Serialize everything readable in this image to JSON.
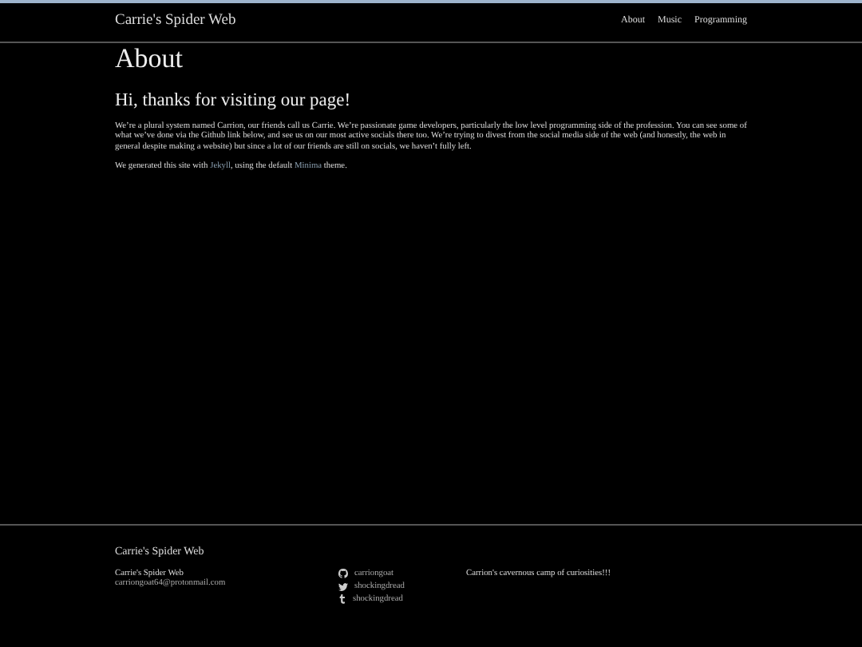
{
  "header": {
    "site_title": "Carrie's Spider Web",
    "nav": [
      "About",
      "Music",
      "Programming"
    ]
  },
  "page": {
    "title": "About",
    "heading": "Hi, thanks for visiting our page!",
    "paragraph": "We’re a plural system named Carrion, our friends call us Carrie. We’re passionate game developers, particularly the low level programming side of the profession. You can see some of what we’ve done via the Github link below, and see us on our most active socials there too. We’re trying to divest from the social media side of the web (and honestly, the web in general despite making a website) but since a lot of our friends are still on socials, we haven’t fully left.",
    "generated": [
      {
        "kind": "text",
        "text": "We generated this site with "
      },
      {
        "kind": "link",
        "text": "Jekyll"
      },
      {
        "kind": "text",
        "text": ", using the default "
      },
      {
        "kind": "link",
        "text": "Minima"
      },
      {
        "kind": "text",
        "text": " theme."
      }
    ]
  },
  "footer": {
    "title": "Carrie's Spider Web",
    "name": "Carrie's Spider Web",
    "email": "carriongoat64@protonmail.com",
    "socials": [
      {
        "kind": "github",
        "handle": "carriongoat"
      },
      {
        "kind": "twitter",
        "handle": "shockingdread"
      },
      {
        "kind": "tumblr",
        "handle": "shockingdread"
      }
    ],
    "description": "Carrion's cavernous camp of curiosities!!!"
  }
}
